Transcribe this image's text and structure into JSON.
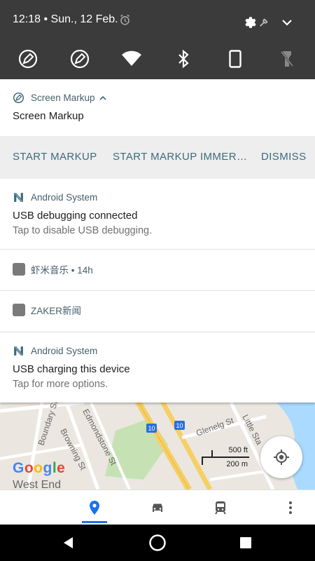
{
  "status_bar": {
    "time_date": "12:18 • Sun., 12 Feb.",
    "icons": [
      "alarm-icon",
      "settings-icon",
      "wrench-icon",
      "expand-icon"
    ]
  },
  "quick_settings": [
    {
      "name": "screen-markup-tile",
      "icon": "pen-circle-icon"
    },
    {
      "name": "screen-markup-alt-tile",
      "icon": "pen-circle-icon"
    },
    {
      "name": "wifi-tile",
      "icon": "wifi-icon"
    },
    {
      "name": "bluetooth-tile",
      "icon": "bluetooth-icon"
    },
    {
      "name": "rotation-tile",
      "icon": "phone-icon"
    },
    {
      "name": "flashlight-tile",
      "icon": "flashlight-off-icon"
    }
  ],
  "notifications": {
    "screen_markup": {
      "app_name": "Screen Markup",
      "title": "Screen Markup",
      "actions": [
        "START MARKUP",
        "START MARKUP IMMER…",
        "DISMISS"
      ]
    },
    "usb_debugging": {
      "app_name": "Android System",
      "title": "USB debugging connected",
      "text": "Tap to disable USB debugging."
    },
    "xiami": {
      "app_name": "虾米音乐 • 14h"
    },
    "zaker": {
      "app_name": "ZAKER新闻"
    },
    "usb_charging": {
      "app_name": "Android System",
      "title": "USB charging this device",
      "text": "Tap for more options."
    }
  },
  "map": {
    "streets": [
      "Boundary St",
      "Browning St",
      "Edmondstone St",
      "Glenelg St",
      "Little Sta"
    ],
    "route_markers": [
      "10",
      "10"
    ],
    "logo": "Google",
    "suburb": "West End",
    "scale_ft": "500 ft",
    "scale_m": "200 m",
    "accent": "#1a73e8"
  },
  "bottom_nav": [
    "explore-icon",
    "car-icon",
    "transit-icon",
    "more-icon"
  ],
  "system_nav": [
    "back-icon",
    "home-icon",
    "recents-icon"
  ]
}
